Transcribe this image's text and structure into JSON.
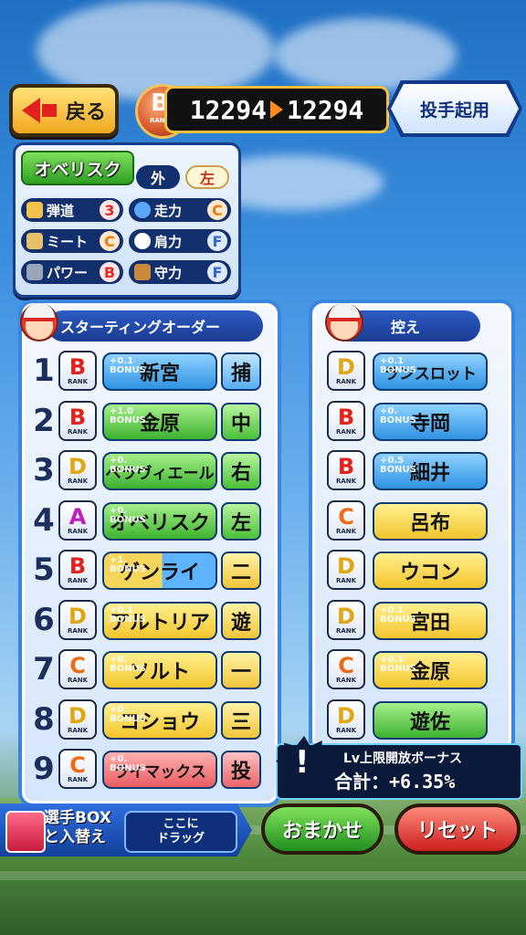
{
  "topbar": {
    "back_label": "戻る",
    "rank_letter": "B",
    "rank_word": "RANK",
    "score_before": "12294",
    "score_after": "12294",
    "pitcher_label": "投手起用"
  },
  "selected_player": {
    "name": "オベリスク",
    "position": "外",
    "hand": "左",
    "stats": [
      {
        "label": "弾道",
        "grade": "3",
        "icon": "bat-trajectory-icon"
      },
      {
        "label": "走力",
        "grade": "C",
        "icon": "running-icon"
      },
      {
        "label": "ミート",
        "grade": "C",
        "icon": "bat-icon"
      },
      {
        "label": "肩力",
        "grade": "F",
        "icon": "throw-ball-icon"
      },
      {
        "label": "パワー",
        "grade": "B",
        "icon": "dumbbell-icon"
      },
      {
        "label": "守力",
        "grade": "F",
        "icon": "glove-icon"
      }
    ]
  },
  "starting_order": {
    "header": "スターティングオーダー",
    "rows": [
      {
        "order": "1",
        "rank": "B",
        "name": "新宮",
        "bonus": "+0.1\nBONUS",
        "position": "捕",
        "color": "blue"
      },
      {
        "order": "2",
        "rank": "B",
        "name": "金原",
        "bonus": "+1.0\nBONUS",
        "position": "中",
        "color": "green"
      },
      {
        "order": "3",
        "rank": "D",
        "name": "ペラヴィエール",
        "bonus": "+0.\nBONUS",
        "position": "右",
        "color": "green"
      },
      {
        "order": "4",
        "rank": "A",
        "name": "オベリスク",
        "bonus": "+0.\nBONUS",
        "position": "左",
        "color": "green"
      },
      {
        "order": "5",
        "rank": "B",
        "name": "ゲンライ",
        "bonus": "+1.\nBONUS",
        "position": "二",
        "color": "half"
      },
      {
        "order": "6",
        "rank": "D",
        "name": "アルトリア",
        "bonus": "+0.1\nBONUS",
        "position": "遊",
        "color": "yellow"
      },
      {
        "order": "7",
        "rank": "C",
        "name": "ソルト",
        "bonus": "+0.\nBONUS",
        "position": "一",
        "color": "yellow"
      },
      {
        "order": "8",
        "rank": "D",
        "name": "コショウ",
        "bonus": "+0.\nBONUS",
        "position": "三",
        "color": "yellow"
      },
      {
        "order": "9",
        "rank": "C",
        "name": "ライマックス",
        "bonus": "+0.\nBONUS",
        "position": "投",
        "color": "red"
      }
    ]
  },
  "bench": {
    "header": "控え",
    "rows": [
      {
        "rank": "D",
        "name": "ランスロット",
        "bonus": "+0.1\nBONUS",
        "color": "blue"
      },
      {
        "rank": "B",
        "name": "寺岡",
        "bonus": "+0.\nBONUS",
        "color": "blue"
      },
      {
        "rank": "B",
        "name": "細井",
        "bonus": "+0.5\nBONUS",
        "color": "blue"
      },
      {
        "rank": "C",
        "name": "呂布",
        "bonus": "",
        "color": "yellow"
      },
      {
        "rank": "D",
        "name": "ウコン",
        "bonus": "",
        "color": "yellow"
      },
      {
        "rank": "D",
        "name": "宮田",
        "bonus": "+0.1\nBONUS",
        "color": "yellow"
      },
      {
        "rank": "C",
        "name": "金原",
        "bonus": "+0.1\nBONUS",
        "color": "yellow"
      },
      {
        "rank": "D",
        "name": "遊佐",
        "bonus": "",
        "color": "green"
      }
    ]
  },
  "bonus_banner": {
    "title": "Lv上限開放ボーナス",
    "total": "合計：+6.35%"
  },
  "bottom": {
    "box_line1": "選手BOX",
    "box_line2": "と入替え",
    "drag_line1": "ここに",
    "drag_line2": "ドラッグ",
    "omakase_label": "おまかせ",
    "reset_label": "リセット"
  },
  "colors": {
    "accent": "#1a3f8a",
    "rank_A": "#c01fc0",
    "rank_B": "#e1231e",
    "rank_C": "#ef6a12",
    "rank_D": "#e0a710"
  }
}
